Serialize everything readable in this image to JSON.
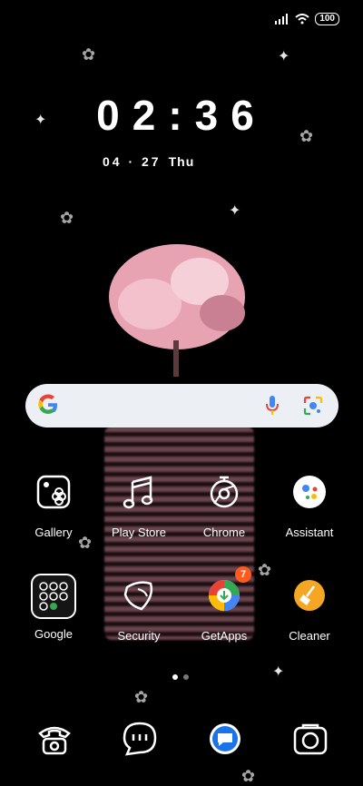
{
  "status": {
    "battery": "100"
  },
  "clock": {
    "time": "02:36",
    "date": "04 · 27",
    "day": "Thu"
  },
  "apps_row1": [
    {
      "label": "Gallery",
      "icon": "gallery-icon"
    },
    {
      "label": "Play Store",
      "icon": "music-notes-icon"
    },
    {
      "label": "Chrome",
      "icon": "chrome-icon"
    },
    {
      "label": "Assistant",
      "icon": "assistant-icon"
    }
  ],
  "apps_row2": [
    {
      "label": "Google",
      "icon": "folder-icon"
    },
    {
      "label": "Security",
      "icon": "shield-icon"
    },
    {
      "label": "GetApps",
      "icon": "getapps-icon",
      "badge": "7"
    },
    {
      "label": "Cleaner",
      "icon": "broom-icon"
    }
  ],
  "dock": [
    {
      "icon": "phone-icon"
    },
    {
      "icon": "messages-icon"
    },
    {
      "icon": "chat-bubble-icon"
    },
    {
      "icon": "camera-icon"
    }
  ],
  "colors": {
    "accent_orange": "#ff5a1f",
    "search_bg": "#eceff3",
    "blue": "#1a73e8"
  }
}
